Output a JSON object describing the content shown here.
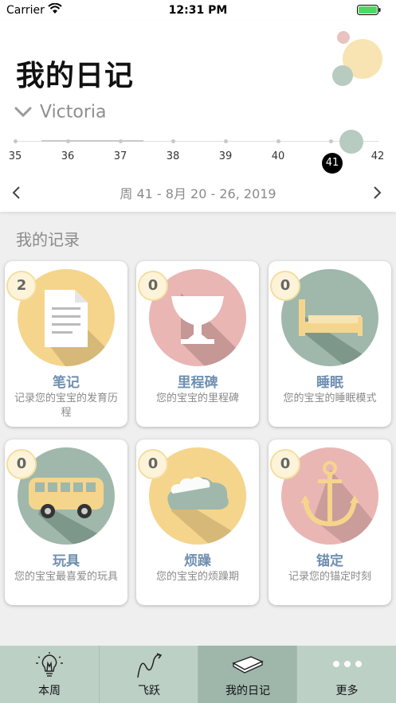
{
  "status": {
    "carrier": "Carrier",
    "time": "12:31 PM"
  },
  "header": {
    "title": "我的日记",
    "child_name": "Victoria"
  },
  "weeks": {
    "ticks": [
      "35",
      "36",
      "37",
      "38",
      "39",
      "40",
      "41",
      "42"
    ],
    "selected": "41"
  },
  "range": {
    "text": "周 41 - 8月 20 - 26, 2019"
  },
  "section_title": "我的记录",
  "cards": [
    {
      "count": "2",
      "label": "笔记",
      "desc": "记录您的宝宝的发育历程",
      "icon": "document-icon",
      "color": "#f5d58c"
    },
    {
      "count": "0",
      "label": "里程碑",
      "desc": "您的宝宝的里程碑",
      "icon": "trophy-icon",
      "color": "#e9b6b4"
    },
    {
      "count": "0",
      "label": "睡眠",
      "desc": "您的宝宝的睡眠模式",
      "icon": "bed-icon",
      "color": "#9fb8ab"
    },
    {
      "count": "0",
      "label": "玩具",
      "desc": "您的宝宝最喜爱的玩具",
      "icon": "bus-icon",
      "color": "#9fb8ab"
    },
    {
      "count": "0",
      "label": "烦躁",
      "desc": "您的宝宝的烦躁期",
      "icon": "cloud-icon",
      "color": "#f5d58c"
    },
    {
      "count": "0",
      "label": "锚定",
      "desc": "记录您的锚定时刻",
      "icon": "anchor-icon",
      "color": "#e9b6b4"
    }
  ],
  "tabs": [
    {
      "label": "本周",
      "icon": "lightbulb-icon"
    },
    {
      "label": "飞跃",
      "icon": "leap-icon"
    },
    {
      "label": "我的日记",
      "icon": "book-icon",
      "active": true
    },
    {
      "label": "更多",
      "icon": "more-icon"
    }
  ]
}
